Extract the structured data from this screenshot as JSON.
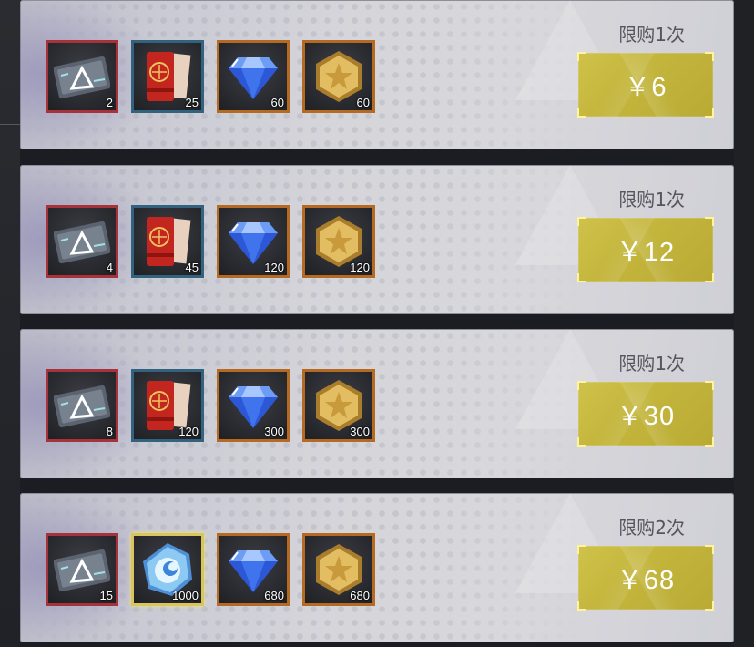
{
  "packs": [
    {
      "limit": "限购1次",
      "price": "￥6",
      "items": [
        {
          "icon": "ticket-card-icon",
          "frame": "red",
          "count": "2"
        },
        {
          "icon": "red-scroll-icon",
          "frame": "blue",
          "count": "25"
        },
        {
          "icon": "blue-diamond-icon",
          "frame": "orange",
          "count": "60"
        },
        {
          "icon": "gold-star-hexagon-icon",
          "frame": "orange",
          "count": "60"
        }
      ]
    },
    {
      "limit": "限购1次",
      "price": "￥12",
      "items": [
        {
          "icon": "ticket-card-icon",
          "frame": "red",
          "count": "4"
        },
        {
          "icon": "red-scroll-icon",
          "frame": "blue",
          "count": "45"
        },
        {
          "icon": "blue-diamond-icon",
          "frame": "orange",
          "count": "120"
        },
        {
          "icon": "gold-star-hexagon-icon",
          "frame": "orange",
          "count": "120"
        }
      ]
    },
    {
      "limit": "限购1次",
      "price": "￥30",
      "items": [
        {
          "icon": "ticket-card-icon",
          "frame": "red",
          "count": "8"
        },
        {
          "icon": "red-scroll-icon",
          "frame": "blue",
          "count": "120"
        },
        {
          "icon": "blue-diamond-icon",
          "frame": "orange",
          "count": "300"
        },
        {
          "icon": "gold-star-hexagon-icon",
          "frame": "orange",
          "count": "300"
        }
      ]
    },
    {
      "limit": "限购2次",
      "price": "￥68",
      "items": [
        {
          "icon": "ticket-card-icon",
          "frame": "red",
          "count": "15"
        },
        {
          "icon": "blue-crystal-orb-icon",
          "frame": "gold",
          "count": "1000"
        },
        {
          "icon": "blue-diamond-icon",
          "frame": "orange",
          "count": "680"
        },
        {
          "icon": "gold-star-hexagon-icon",
          "frame": "orange",
          "count": "680"
        }
      ]
    }
  ],
  "colors": {
    "price_button": "#c4b63d",
    "limit_text": "#55565c",
    "frame_red": "#a8323a",
    "frame_blue": "#33627f",
    "frame_orange": "#b56a24",
    "frame_gold": "#d8c65a"
  }
}
